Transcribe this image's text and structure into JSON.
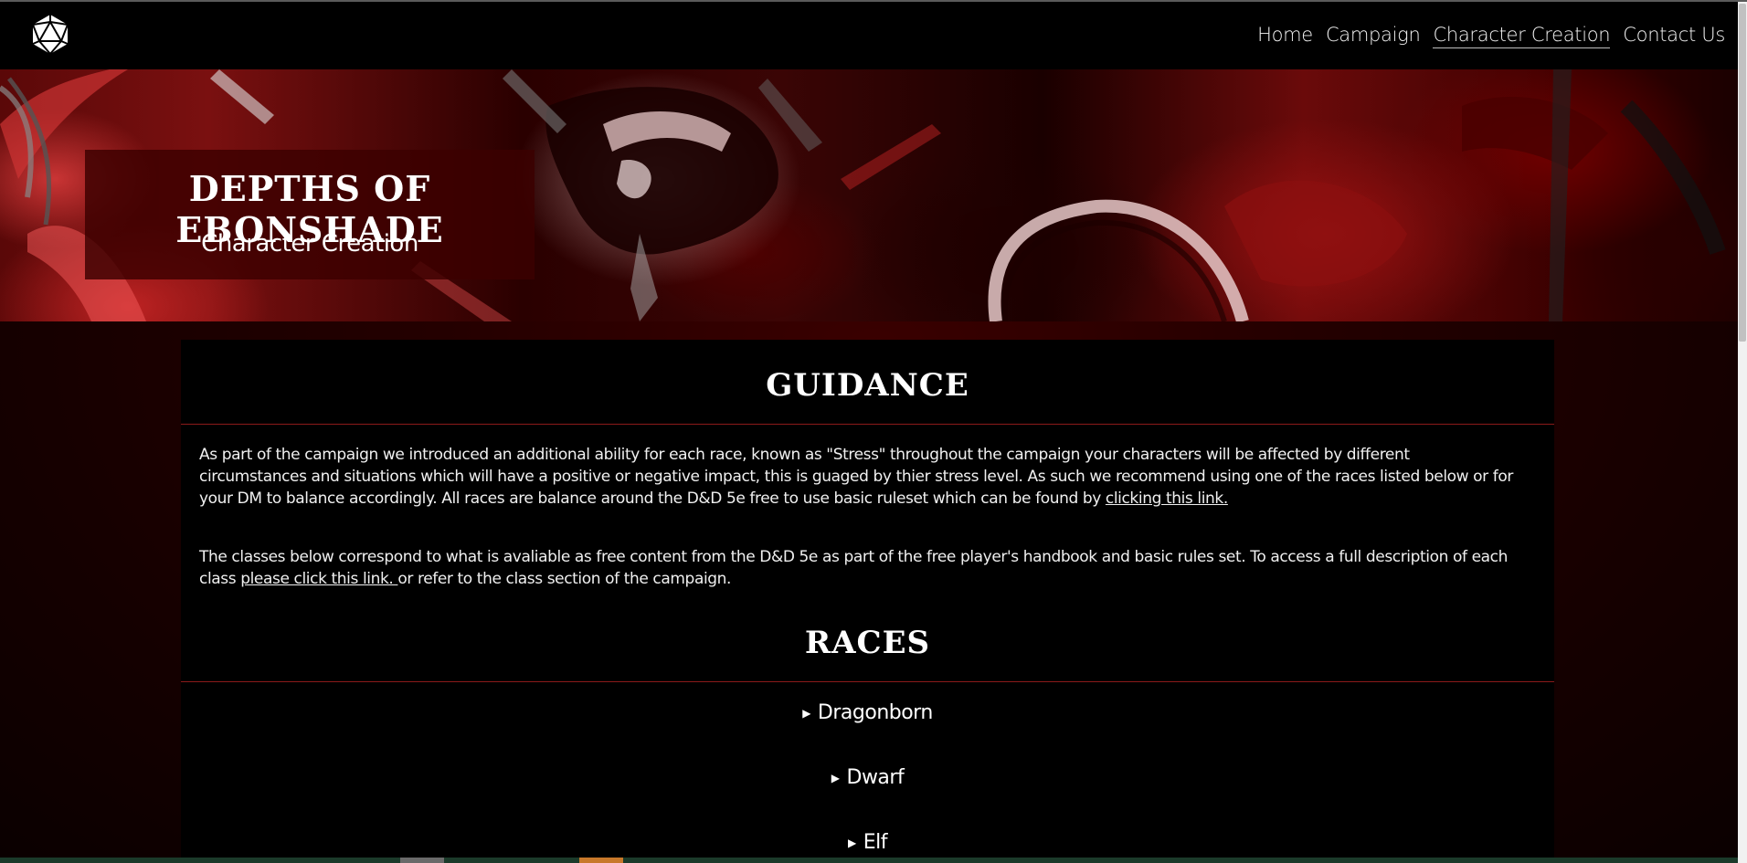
{
  "brand": {
    "logo_icon": "d20-dice-icon"
  },
  "nav": {
    "links": [
      {
        "label": "Home"
      },
      {
        "label": "Campaign"
      },
      {
        "label": "Character Creation",
        "active": true
      },
      {
        "label": "Contact Us"
      }
    ]
  },
  "hero": {
    "title": "DEPTHS OF EBONSHADE",
    "subtitle": "Character Creation"
  },
  "guidance": {
    "heading": "GUIDANCE",
    "para1_text": "As part of the campaign we introduced an additional ability for each race, known as \"Stress\" throughout the campaign your characters will be affected by different circumstances and situations which will have a positive or negative impact, this is guaged by thier stress level. As such we recommend using one of the races listed below or for your DM to balance accordingly. All races are balance around the D&D 5e free to use basic ruleset which can be found by ",
    "para1_link": "clicking this link.",
    "para2_text": "The classes below correspond to what is avaliable as free content from the D&D 5e as part of the free player's handbook and basic rules set. To access a full description of each class ",
    "para2_link": "please click this link. ",
    "para2_after": "or refer to the class section of the campaign."
  },
  "races": {
    "heading": "RACES",
    "marker": "▶",
    "items": [
      {
        "label": "Dragonborn"
      },
      {
        "label": "Dwarf"
      },
      {
        "label": "Elf"
      }
    ]
  },
  "colors": {
    "accent_red": "#8b1a1a",
    "panel_bg": "#000000",
    "page_bg": "#240000"
  }
}
